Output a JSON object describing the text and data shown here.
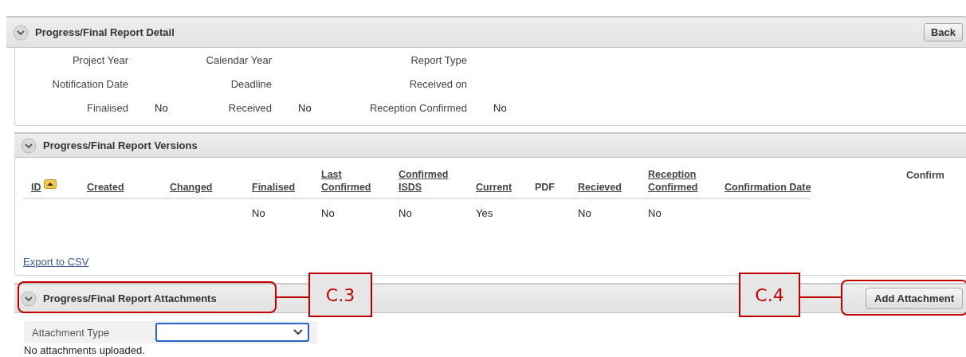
{
  "detail": {
    "title": "Progress/Final Report Detail",
    "expanded": true,
    "back_button": "Back",
    "fields": [
      [
        {
          "label": "Project Year"
        },
        {
          "label": "Calendar Year"
        },
        {
          "label": "Report Type"
        }
      ],
      [
        {
          "label": "Notification Date"
        },
        {
          "label": "Deadline"
        },
        {
          "label": "Received on"
        }
      ],
      [
        {
          "label": "Finalised",
          "value": "No"
        },
        {
          "label": "Received",
          "value": "No"
        },
        {
          "label": "Reception Confirmed",
          "value": "No"
        }
      ]
    ]
  },
  "versions": {
    "title": "Progress/Final Report Versions",
    "expanded": true,
    "columns": [
      {
        "label": "ID",
        "sortable": true,
        "sorted": true
      },
      {
        "label": "Created",
        "sortable": true,
        "sorted": false
      },
      {
        "label": "Changed",
        "sortable": true,
        "sorted": false
      },
      {
        "label": "Finalised",
        "sortable": true,
        "sorted": false
      },
      {
        "label": "Last Confirmed",
        "sortable": true,
        "sorted": false
      },
      {
        "label": "Confirmed ISDS",
        "sortable": true,
        "sorted": false
      },
      {
        "label": "Current",
        "sortable": true,
        "sorted": false
      },
      {
        "label": "PDF",
        "sortable": false,
        "sorted": false
      },
      {
        "label": "Recieved",
        "sortable": true,
        "sorted": false
      },
      {
        "label": "Reception Confirmed",
        "sortable": true,
        "sorted": false
      },
      {
        "label": "Confirmation Date",
        "sortable": true,
        "sorted": false
      }
    ],
    "action_column": "Confirm",
    "rows": [
      [
        null,
        null,
        null,
        "No",
        "No",
        "No",
        "Yes",
        null,
        "No",
        "No",
        null
      ]
    ],
    "export_link": "Export to CSV"
  },
  "attachments": {
    "title": "Progress/Final Report Attachments",
    "expanded": true,
    "add_button": "Add Attachment",
    "filter_label": "Attachment Type",
    "empty_message": "No attachments uploaded."
  },
  "annotations": [
    {
      "label": "C.3"
    },
    {
      "label": "C.4"
    }
  ]
}
